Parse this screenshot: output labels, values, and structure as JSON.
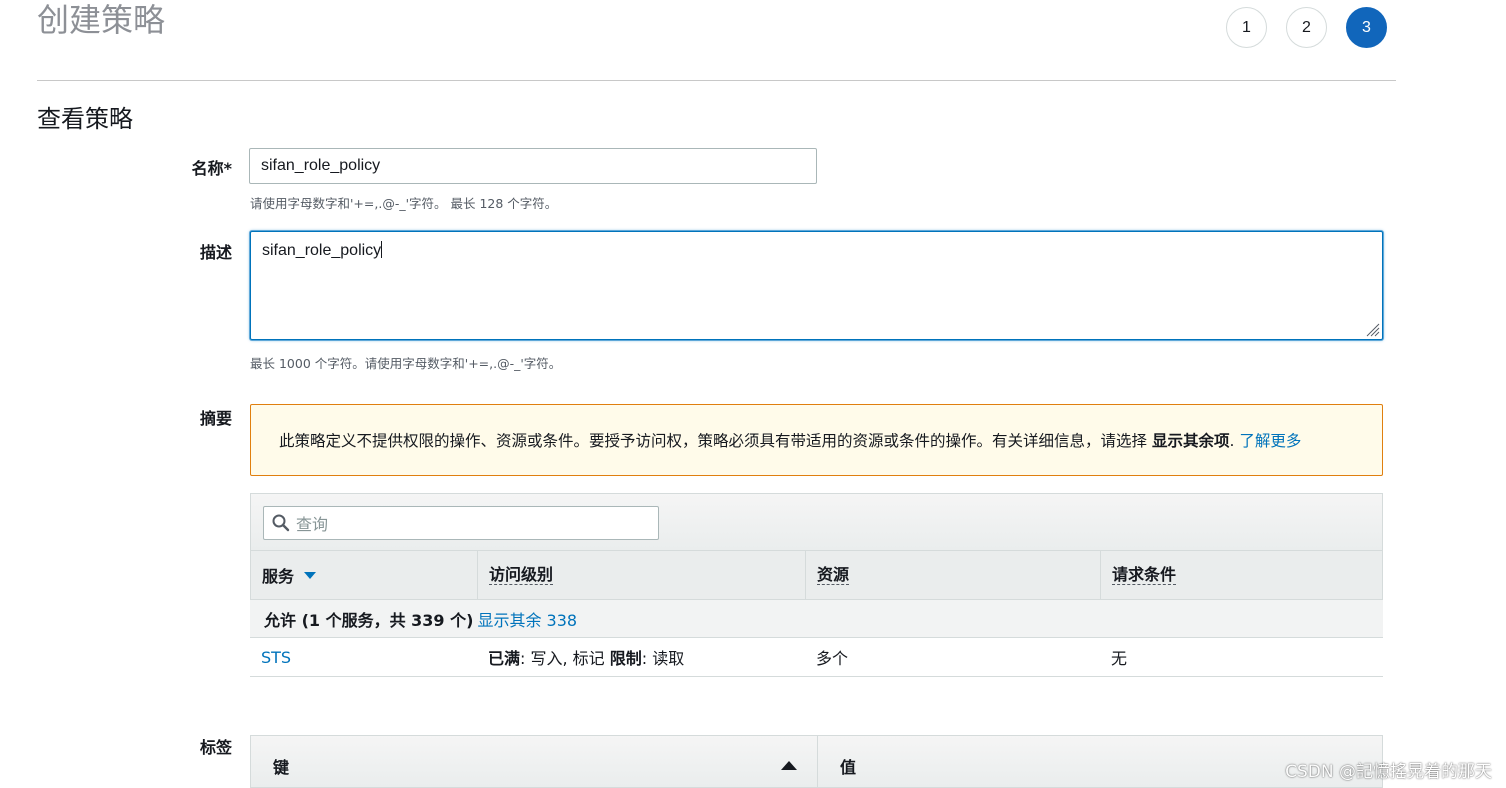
{
  "page": {
    "title": "创建策略",
    "steps": [
      "1",
      "2",
      "3"
    ],
    "active_step": "3",
    "section_title": "查看策略"
  },
  "form": {
    "name_label": "名称*",
    "name_value": "sifan_role_policy",
    "name_hint": "请使用字母数字和'+=,.@-_'字符。 最长 128 个字符。",
    "desc_label": "描述",
    "desc_value": "sifan_role_policy",
    "desc_hint": "最长 1000 个字符。请使用字母数字和'+=,.@-_'字符。",
    "summary_label": "摘要",
    "tags_label": "标签"
  },
  "alert": {
    "text": "此策略定义不提供权限的操作、资源或条件。要授予访问权，策略必须具有带适用的资源或条件的操作。有关详细信息，请选择 ",
    "bold": "显示其余项",
    "period": ". ",
    "link": "了解更多"
  },
  "summary_table": {
    "search_placeholder": "查询",
    "columns": [
      "服务",
      "访问级别",
      "资源",
      "请求条件"
    ],
    "group": {
      "text": "允许 (1 个服务，共 339 个)",
      "link": "显示其余 338"
    },
    "rows": [
      {
        "service": "STS",
        "access_bold_1": "已满",
        "access_text_1": ": 写入, 标记",
        "access_bold_2": "限制",
        "access_text_2": ": 读取",
        "resource": "多个",
        "condition": "无"
      }
    ]
  },
  "tags_table": {
    "columns": [
      "键",
      "值"
    ]
  },
  "watermark": "CSDN @記憶搖晃着的那天",
  "colors": {
    "primary": "#0073bb",
    "active_step": "#1166bb",
    "alert_border": "#e07f0f",
    "alert_bg": "#fffbea"
  }
}
